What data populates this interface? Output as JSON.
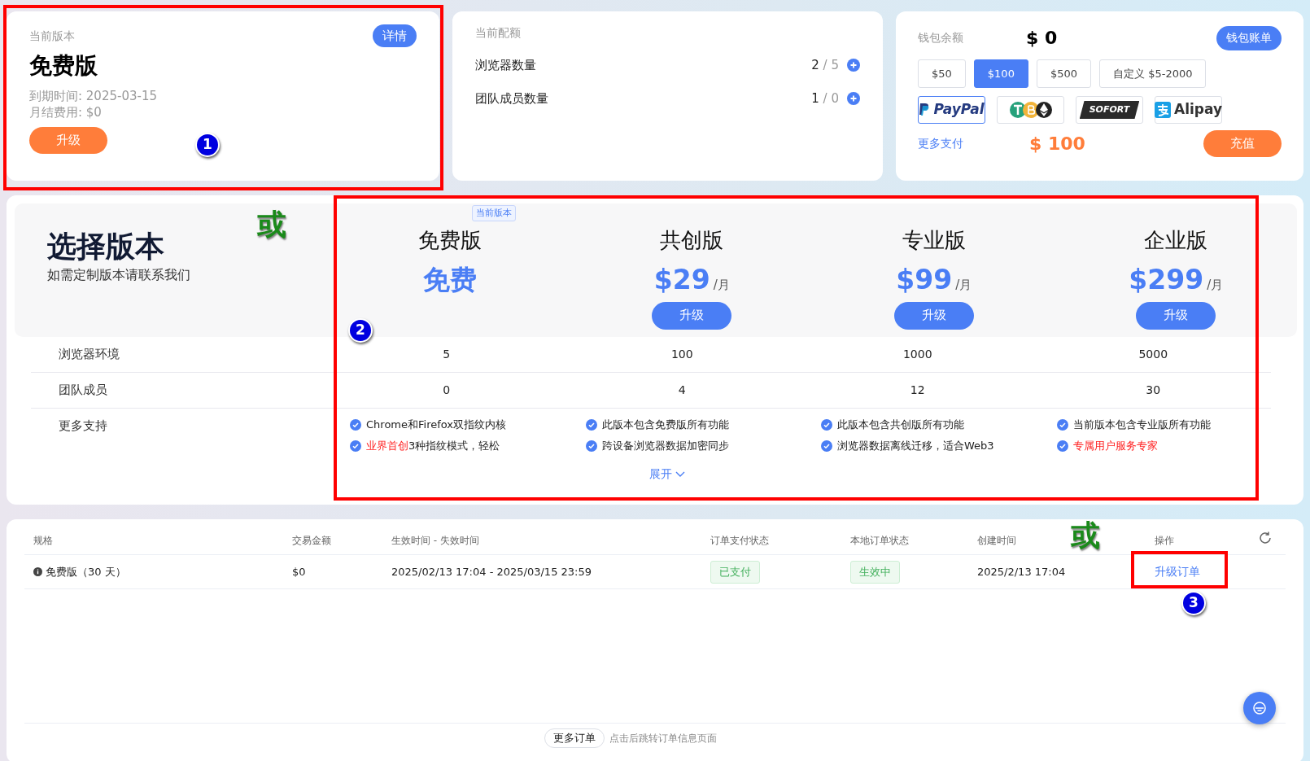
{
  "current_plan": {
    "label": "当前版本",
    "details_button": "详情",
    "name": "免费版",
    "expiry": "到期时间: 2025-03-15",
    "monthly_fee": "月结费用: $0",
    "upgrade_button": "升级"
  },
  "quota": {
    "label": "当前配额",
    "items": [
      {
        "name": "浏览器数量",
        "used": "2",
        "sep": "/",
        "total": "5"
      },
      {
        "name": "团队成员数量",
        "used": "1",
        "sep": "/",
        "total": "0"
      }
    ]
  },
  "wallet": {
    "label": "钱包余额",
    "balance": "$ 0",
    "bill_button": "钱包账单",
    "amounts": [
      {
        "label": "$50",
        "selected": false
      },
      {
        "label": "$100",
        "selected": true
      },
      {
        "label": "$500",
        "selected": false
      },
      {
        "label": "自定义 $5-2000",
        "selected": false
      }
    ],
    "methods": [
      {
        "kind": "paypal",
        "label": "PayPal",
        "selected": true
      },
      {
        "kind": "crypto",
        "selected": false
      },
      {
        "kind": "sofort",
        "label": "SOFORT",
        "selected": false
      },
      {
        "kind": "alipay",
        "label": "Alipay",
        "selected": false
      }
    ],
    "more_link": "更多支付",
    "total": "$ 100",
    "recharge_button": "充值"
  },
  "plans": {
    "title": "选择版本",
    "subtitle": "如需定制版本请联系我们",
    "current_tag": "当前版本",
    "row_labels": [
      "浏览器环境",
      "团队成员",
      "更多支持"
    ],
    "columns": [
      {
        "name": "免费版",
        "price": "免费",
        "current": true,
        "browsers": "5",
        "members": "0",
        "features": [
          [
            {
              "text": "Chrome和Firefox双指纹内核",
              "accent": false
            }
          ],
          [
            {
              "text": "业界首创",
              "accent": true
            },
            {
              "text": "3种指纹模式，轻松",
              "accent": false
            }
          ]
        ]
      },
      {
        "name": "共创版",
        "price": "$29",
        "per": "/月",
        "current": false,
        "button": "升级",
        "browsers": "100",
        "members": "4",
        "features": [
          [
            {
              "text": "此版本包含免费版所有功能",
              "accent": false
            }
          ],
          [
            {
              "text": "跨设备浏览器数据加密同步",
              "accent": false
            }
          ]
        ]
      },
      {
        "name": "专业版",
        "price": "$99",
        "per": "/月",
        "current": false,
        "button": "升级",
        "browsers": "1000",
        "members": "12",
        "features": [
          [
            {
              "text": "此版本包含共创版所有功能",
              "accent": false
            }
          ],
          [
            {
              "text": "浏览器数据离线迁移，适合Web3",
              "accent": false
            }
          ]
        ]
      },
      {
        "name": "企业版",
        "price": "$299",
        "per": "/月",
        "current": false,
        "button": "升级",
        "browsers": "5000",
        "members": "30",
        "features": [
          [
            {
              "text": "当前版本包含专业版所有功能",
              "accent": false
            }
          ],
          [
            {
              "text": "专属用户服务专家",
              "accent": true
            }
          ]
        ]
      }
    ],
    "expand_link": "展开"
  },
  "orders": {
    "columns": [
      "规格",
      "交易金额",
      "生效时间 - 失效时间",
      "订单支付状态",
      "本地订单状态",
      "创建时间",
      "操作"
    ],
    "rows": [
      {
        "spec": "免费版（30 天）",
        "amount": "$0",
        "period": "2025/02/13 17:04 - 2025/03/15 23:59",
        "pay_status": "已支付",
        "local_status": "生效中",
        "created": "2025/2/13 17:04",
        "action": "升级订单"
      }
    ],
    "more_button": "更多订单",
    "more_hint": "点击后跳转订单信息页面"
  },
  "annotations": {
    "or_marks": [
      "或",
      "或"
    ],
    "badges": [
      "1",
      "2",
      "3"
    ]
  }
}
